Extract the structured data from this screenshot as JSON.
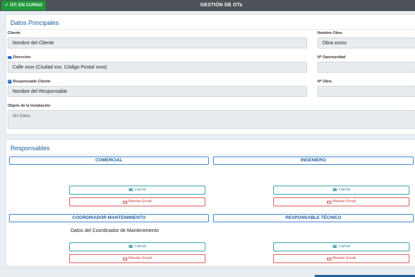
{
  "header": {
    "status_badge": "OT: EN CURSO",
    "title": "GESTIÓN DE OTs"
  },
  "datos_principales": {
    "title": "Datos Principales",
    "cliente": {
      "label": "Cliente",
      "value": "Nombre del Cliente"
    },
    "nombre_obra": {
      "label": "Nombre Obra",
      "value": "Obra xxxxx"
    },
    "direccion": {
      "label": "Dirección",
      "value": "Calle xxxx (Ciudad xxx, Código Postal xxxx)",
      "icon": "car-icon"
    },
    "oportunidad": {
      "label": "Nº Oportunidad",
      "value": ""
    },
    "responsable_cliente": {
      "label": "Responsable Cliente",
      "value": "Nombre del Responsable",
      "icon": "info-icon"
    },
    "n_obra": {
      "label": "Nº Obra",
      "value": ""
    },
    "objeto": {
      "label": "Objeto de la Instalación",
      "value": "Sin Datos"
    }
  },
  "responsables": {
    "title": "Responsables",
    "call_label": "Llamar",
    "mail_label": "Mandar Email",
    "cards": [
      {
        "title": "COMERCIAL",
        "body": ""
      },
      {
        "title": "INGENIERO",
        "body": ""
      },
      {
        "title": "COORDINADOR MANTENIMIENTO",
        "body": "Datos del Coordinador de Mantenimiento"
      },
      {
        "title": "RESPONSABLE TÉCNICO",
        "body": ""
      }
    ]
  },
  "colors": {
    "accent": "#1c5a9c",
    "status_green": "#1f9a3b",
    "topbar": "#4d5359",
    "call": "#2a8f99",
    "mail": "#d04545"
  }
}
